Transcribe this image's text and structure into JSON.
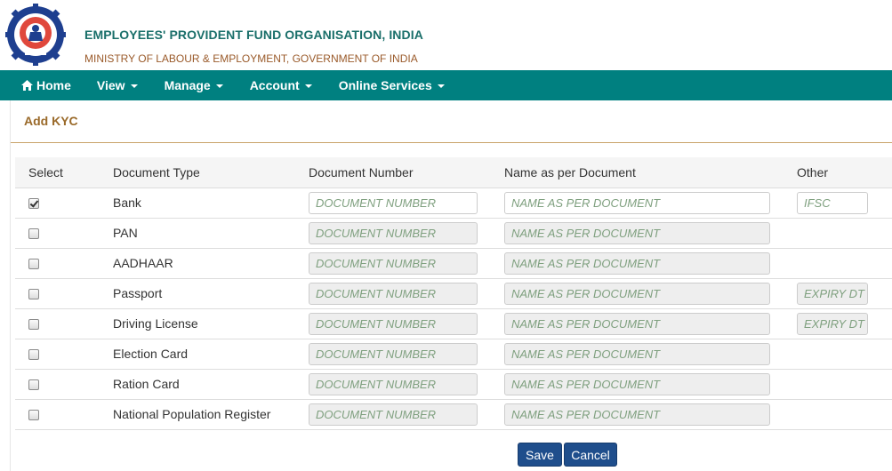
{
  "header": {
    "org_name": "EMPLOYEES' PROVIDENT FUND ORGANISATION, INDIA",
    "ministry": "MINISTRY OF LABOUR & EMPLOYMENT, GOVERNMENT OF INDIA",
    "logo_icon": "epfo-emblem-icon"
  },
  "nav": {
    "home": "Home",
    "view": "View",
    "manage": "Manage",
    "account": "Account",
    "online_services": "Online Services"
  },
  "page": {
    "title": "Add KYC"
  },
  "table": {
    "headers": [
      "Select",
      "Document Type",
      "Document Number",
      "Name as per Document",
      "Other"
    ],
    "rows": [
      {
        "checked": true,
        "type": "Bank",
        "number_placeholder": "DOCUMENT NUMBER",
        "name_placeholder": "NAME AS PER DOCUMENT",
        "other_placeholder": "IFSC",
        "enabled": true
      },
      {
        "checked": false,
        "type": "PAN",
        "number_placeholder": "DOCUMENT NUMBER",
        "name_placeholder": "NAME AS PER DOCUMENT",
        "other_placeholder": "",
        "enabled": false
      },
      {
        "checked": false,
        "type": "AADHAAR",
        "number_placeholder": "DOCUMENT NUMBER",
        "name_placeholder": "NAME AS PER DOCUMENT",
        "other_placeholder": "",
        "enabled": false
      },
      {
        "checked": false,
        "type": "Passport",
        "number_placeholder": "DOCUMENT NUMBER",
        "name_placeholder": "NAME AS PER DOCUMENT",
        "other_placeholder": "EXPIRY DT",
        "enabled": false
      },
      {
        "checked": false,
        "type": "Driving License",
        "number_placeholder": "DOCUMENT NUMBER",
        "name_placeholder": "NAME AS PER DOCUMENT",
        "other_placeholder": "EXPIRY DT",
        "enabled": false
      },
      {
        "checked": false,
        "type": "Election Card",
        "number_placeholder": "DOCUMENT NUMBER",
        "name_placeholder": "NAME AS PER DOCUMENT",
        "other_placeholder": "",
        "enabled": false
      },
      {
        "checked": false,
        "type": "Ration Card",
        "number_placeholder": "DOCUMENT NUMBER",
        "name_placeholder": "NAME AS PER DOCUMENT",
        "other_placeholder": "",
        "enabled": false
      },
      {
        "checked": false,
        "type": "National Population Register",
        "number_placeholder": "DOCUMENT NUMBER",
        "name_placeholder": "NAME AS PER DOCUMENT",
        "other_placeholder": "",
        "enabled": false
      }
    ]
  },
  "buttons": {
    "save": "Save",
    "cancel": "Cancel"
  },
  "colors": {
    "nav_bg": "#008080",
    "org_text": "#1a6f6a",
    "title_text": "#9a6a2a",
    "button_bg": "#1f4e8c"
  }
}
